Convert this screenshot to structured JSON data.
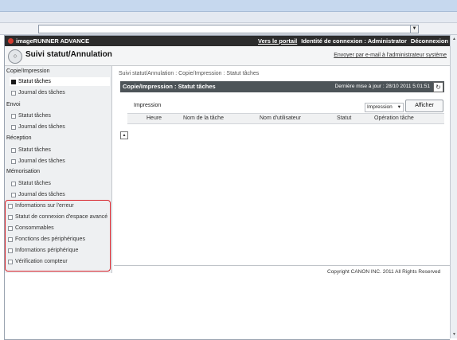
{
  "browser": {
    "address_dropdown_glyph": "▼"
  },
  "header": {
    "brand": "imageRUNNER ADVANCE",
    "portal_link": "Vers le portail",
    "login_info": "Identité de connexion : Administrator",
    "logout_link": "Déconnexion",
    "page_title": "Suivi statut/Annulation",
    "email_admin_link": "Envoyer par e-mail à l'administrateur système"
  },
  "sidebar": {
    "sections": [
      {
        "title": "Copie/Impression",
        "items": [
          {
            "label": "Statut tâches",
            "selected": true
          },
          {
            "label": "Journal des tâches",
            "selected": false
          }
        ]
      },
      {
        "title": "Envoi",
        "items": [
          {
            "label": "Statut tâches",
            "selected": false
          },
          {
            "label": "Journal des tâches",
            "selected": false
          }
        ]
      },
      {
        "title": "Réception",
        "items": [
          {
            "label": "Statut tâches",
            "selected": false
          },
          {
            "label": "Journal des tâches",
            "selected": false
          }
        ]
      },
      {
        "title": "Mémorisation",
        "items": [
          {
            "label": "Statut tâches",
            "selected": false
          },
          {
            "label": "Journal des tâches",
            "selected": false
          }
        ]
      }
    ],
    "extra_items": [
      "Informations sur l'erreur",
      "Statut de connexion d'espace avancé",
      "Consommables",
      "Fonctions des périphériques",
      "Informations périphérique",
      "Vérification compteur"
    ],
    "highlight_color": "#d8242c"
  },
  "main": {
    "breadcrumb": "Suivi statut/Annulation : Copie/Impression : Statut tâches",
    "panel_title": "Copie/Impression : Statut tâches",
    "last_update": "Dernière mise à jour : 28/10 2011 5:01:51",
    "table_title": "Impression",
    "filter_value": "Impression",
    "show_button": "Afficher",
    "columns": [
      "Heure",
      "Nom de la tâche",
      "Nom d'utilisateur",
      "Statut",
      "Opération tâche"
    ],
    "copyright": "Copyright CANON INC. 2011 All Rights Reserved"
  }
}
